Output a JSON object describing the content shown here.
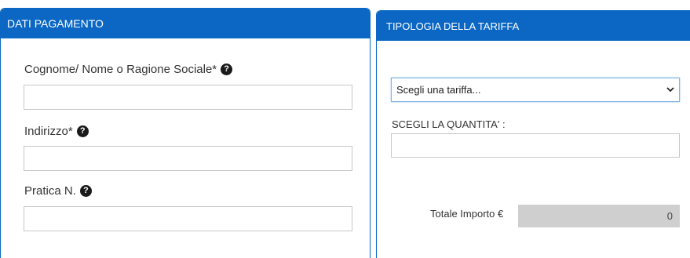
{
  "payment": {
    "title": "DATI PAGAMENTO",
    "fields": [
      {
        "label": "Cognome/ Nome o Ragione Sociale*",
        "value": ""
      },
      {
        "label": "Indirizzo*",
        "value": ""
      },
      {
        "label": "Pratica N.",
        "value": ""
      }
    ],
    "help_icon": "question-circle-icon"
  },
  "tariff": {
    "title": "TIPOLOGIA DELLA TARIFFA",
    "select_value": "Scegli una tariffa...",
    "quantity_label": "SCEGLI LA QUANTITA' :",
    "quantity_value": "",
    "total_label": "Totale Importo €",
    "total_value": "0"
  },
  "colors": {
    "header_bg": "#0b67c3",
    "readonly_bg": "#cfcfcf"
  }
}
